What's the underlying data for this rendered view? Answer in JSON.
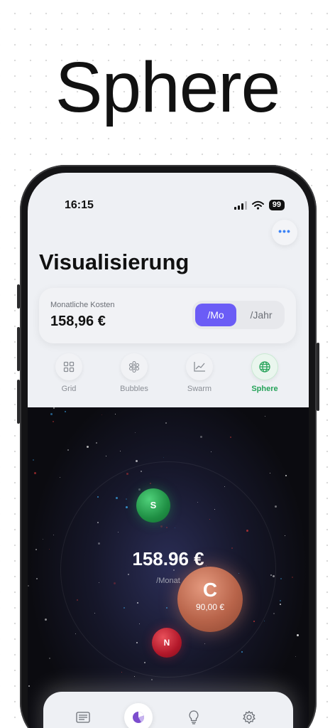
{
  "hero": {
    "title": "Sphere"
  },
  "status_bar": {
    "time": "16:15",
    "battery": "99"
  },
  "header": {
    "more_label": "•••",
    "title": "Visualisierung"
  },
  "cost_card": {
    "label": "Monatliche Kosten",
    "value": "158,96 €",
    "toggle": {
      "monthly": "/Mo",
      "yearly": "/Jahr",
      "selected": "/Mo"
    }
  },
  "viz_tabs": [
    {
      "label": "Grid",
      "icon": "grid-icon",
      "active": false
    },
    {
      "label": "Bubbles",
      "icon": "bubbles-icon",
      "active": false
    },
    {
      "label": "Swarm",
      "icon": "chart-line-icon",
      "active": false
    },
    {
      "label": "Sphere",
      "icon": "globe-icon",
      "active": true
    }
  ],
  "sphere": {
    "total": "158.96 €",
    "period": "/Monat",
    "bubbles": [
      {
        "letter": "S",
        "color": "#27a35a"
      },
      {
        "letter": "C",
        "amount": "90,00 €",
        "color": "#c8735a"
      },
      {
        "letter": "N",
        "color": "#c21d2f"
      }
    ]
  },
  "tab_bar": [
    {
      "icon": "list-icon",
      "active": false
    },
    {
      "icon": "pie-chart-icon",
      "active": true
    },
    {
      "icon": "lightbulb-icon",
      "active": false
    },
    {
      "icon": "gear-icon",
      "active": false
    }
  ],
  "colors": {
    "accent": "#6b5cf6",
    "active_green": "#27a35a",
    "more_blue": "#3b82f6"
  }
}
